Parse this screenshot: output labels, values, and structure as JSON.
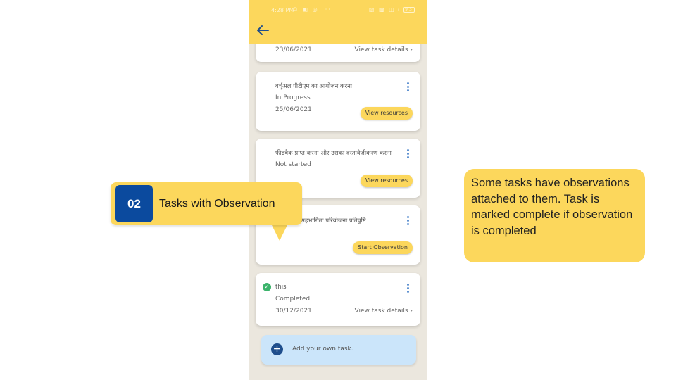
{
  "statusbar": {
    "time": "4:28 PM",
    "left_icons": "© ▣ ◎ ···",
    "right_icons": "▨ ▩ ◫ᵢₗ",
    "battery": "93"
  },
  "cards": [
    {
      "date": "23/06/2021",
      "action": "View task details"
    },
    {
      "title": "वर्चुअल पीटीएम का आयोजन करना",
      "status": "In Progress",
      "date": "25/06/2021",
      "action": "View resources"
    },
    {
      "title": "फीडबैक प्राप्त करना और उसका दस्तावेजीकरण करना",
      "status": "Not started",
      "action": "View resources"
    },
    {
      "title": "सामुदायिक सहभागिता परियोजना प्रतिपुष्टि",
      "action": "Start Observation"
    },
    {
      "title": "this",
      "status": "Completed",
      "date": "30/12/2021",
      "action": "View task details"
    }
  ],
  "add_task": {
    "label": "Add your own task."
  },
  "callout": {
    "number": "02",
    "text": "Tasks with Observation"
  },
  "note": {
    "text": "Some tasks have observations attached to them. Task is marked complete if observation is completed"
  },
  "colors": {
    "accent": "#fcd75c",
    "number_box": "#0b4a9e",
    "background": "#ebe7de",
    "add_task_bg": "#cbe5fa"
  },
  "icons": {
    "back": "arrow-left-icon",
    "more": "more-vertical-icon",
    "check": "check-circle-icon",
    "add": "plus-circle-icon",
    "chevron": "chevron-right-icon"
  }
}
